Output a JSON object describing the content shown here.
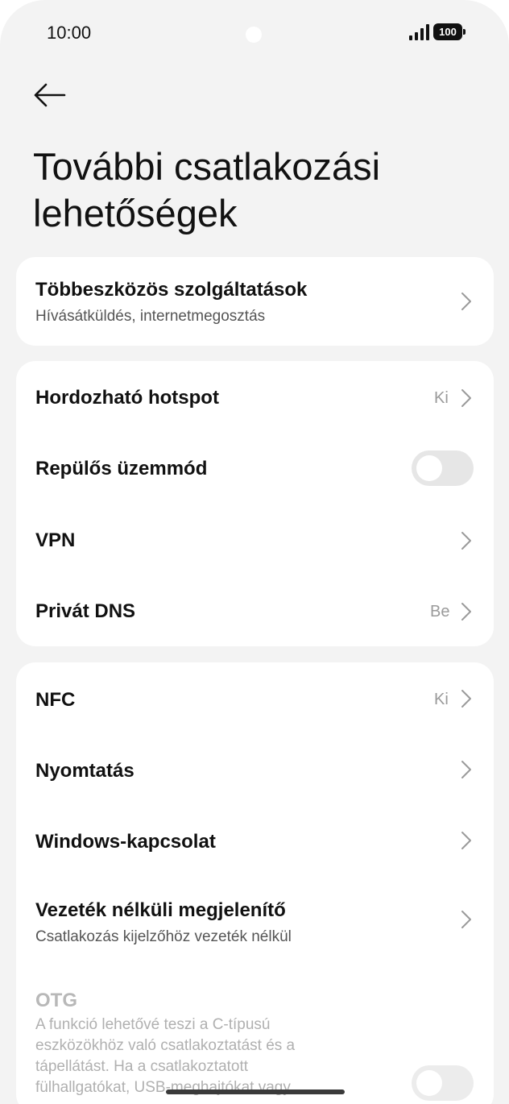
{
  "status_bar": {
    "time": "10:00",
    "battery": "100"
  },
  "header": {
    "back_icon": "arrow-left-icon",
    "title": "További csatlakozási lehetőségek"
  },
  "card1": {
    "items": [
      {
        "title": "Többeszközös szolgáltatások",
        "subtitle": "Hívásátküldés, internetmegosztás"
      }
    ]
  },
  "card2": {
    "items": [
      {
        "title": "Hordozható hotspot",
        "value": "Ki"
      },
      {
        "title": "Repülős üzemmód",
        "toggle": false
      },
      {
        "title": "VPN"
      },
      {
        "title": "Privát DNS",
        "value": "Be"
      }
    ]
  },
  "card3": {
    "items": [
      {
        "title": "NFC",
        "value": "Ki"
      },
      {
        "title": "Nyomtatás"
      },
      {
        "title": "Windows-kapcsolat"
      },
      {
        "title": "Vezeték nélküli megjelenítő",
        "subtitle": "Csatlakozás kijelzőhöz vezeték nélkül"
      },
      {
        "title": "OTG",
        "description": "A funkció lehetővé teszi a C-típusú eszközökhöz való csatlakoztatást és a tápellátást. Ha a csatlakoztatott fülhallgatókat, USB-meghajtókat vagy",
        "toggle": false,
        "disabled": true
      }
    ]
  },
  "colors": {
    "background": "#f3f3f3",
    "card": "#ffffff",
    "toggle_off": "#e6e6e6",
    "secondary_text": "#9a9a9a"
  }
}
